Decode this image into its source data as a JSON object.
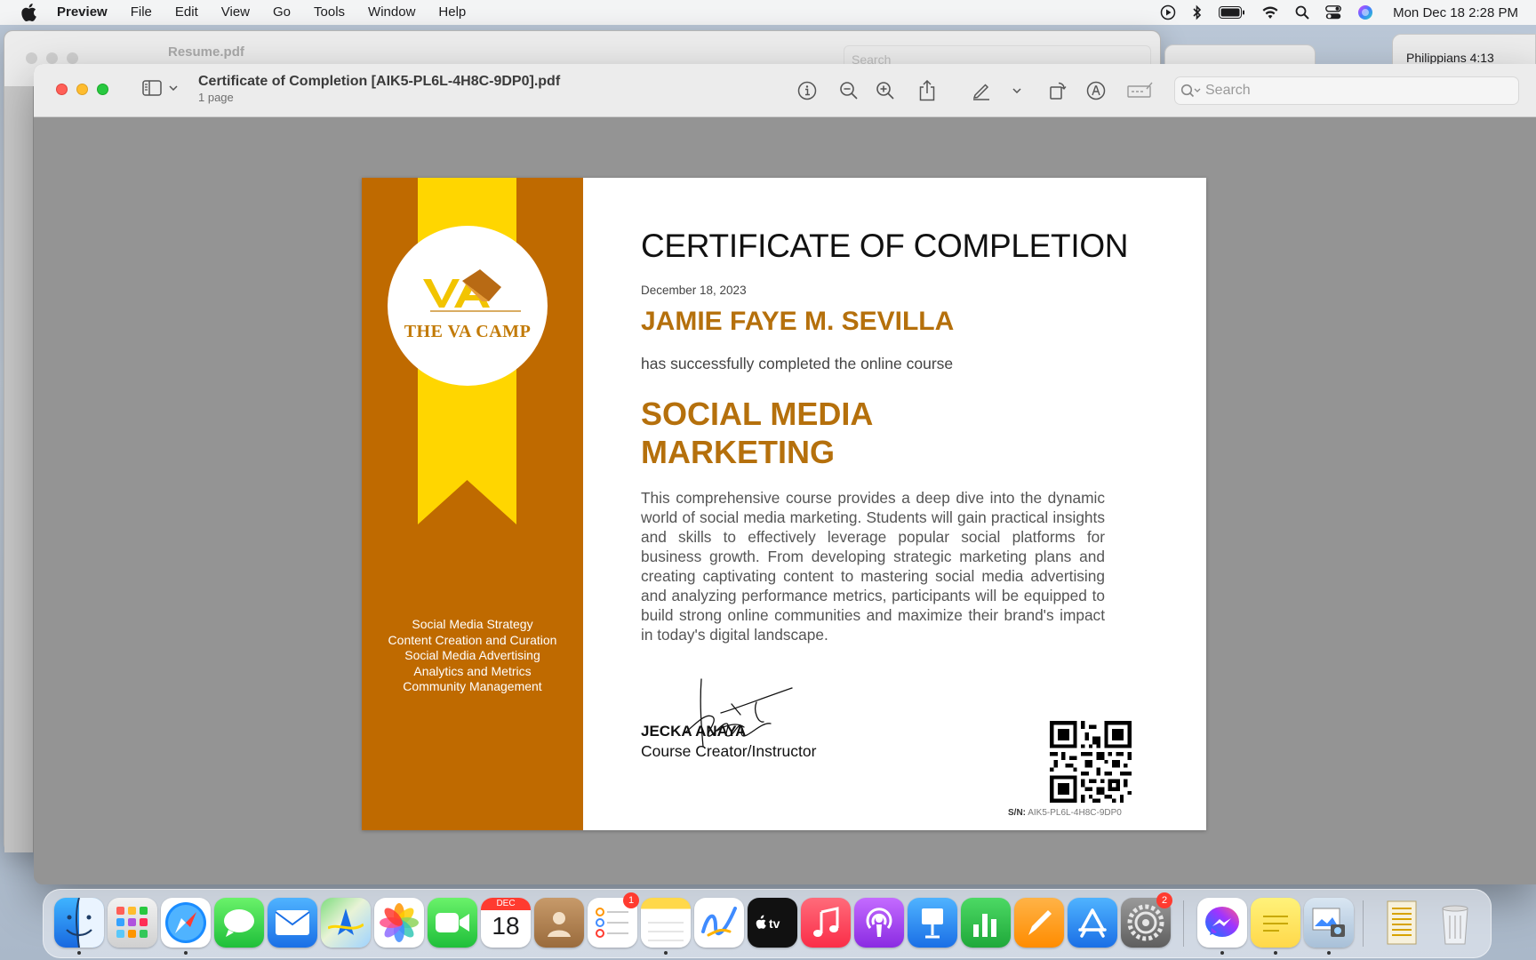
{
  "menubar": {
    "app_name": "Preview",
    "menus": [
      "File",
      "Edit",
      "View",
      "Go",
      "Tools",
      "Window",
      "Help"
    ],
    "clock": "Mon Dec 18  2:28 PM"
  },
  "background_windows": {
    "resume_title": "Resume.pdf",
    "search_placeholder": "Search",
    "bible_title": "Philippians 4:13"
  },
  "window": {
    "title": "Certificate of Completion [AIK5-PL6L-4H8C-9DP0].pdf",
    "subtitle": "1 page",
    "search_placeholder": "Search"
  },
  "certificate": {
    "logo_text": "THE VA CAMP",
    "topics": [
      "Social Media Strategy",
      "Content Creation and Curation",
      "Social Media Advertising",
      "Analytics and Metrics",
      "Community Management"
    ],
    "heading": "CERTIFICATE OF COMPLETION",
    "date": "December 18, 2023",
    "recipient": "JAMIE FAYE M. SEVILLA",
    "intro": "has successfully completed the online course",
    "course_line1": "SOCIAL MEDIA",
    "course_line2": "MARKETING",
    "description": "This comprehensive course provides a deep dive into the dynamic world of social media marketing. Students will gain practical insights and skills to effectively leverage popular social platforms for business growth. From developing strategic marketing plans and creating captivating content to mastering social media advertising and analyzing performance metrics, participants will be equipped to build strong online communities and maximize their brand's impact in today's digital landscape.",
    "instructor_name": "JECKA ANAYA",
    "instructor_role": "Course Creator/Instructor",
    "serial_label": "S/N:",
    "serial_value": "AIK5-PL6L-4H8C-9DP0",
    "colors": {
      "brand_orange": "#bf6a00",
      "ribbon_yellow": "#ffd600",
      "title_gold": "#b5700c"
    }
  },
  "dock": {
    "calendar_month": "DEC",
    "calendar_day": "18",
    "reminders_badge": "1",
    "settings_badge": "2",
    "apps": [
      "finder-icon",
      "launchpad-icon",
      "safari-icon",
      "messages-icon",
      "mail-icon",
      "maps-icon",
      "photos-icon",
      "facetime-icon",
      "calendar-icon",
      "contacts-icon",
      "reminders-icon",
      "notes-icon",
      "freeform-icon",
      "apple-tv-icon",
      "music-icon",
      "podcasts-icon",
      "keynote-icon",
      "numbers-icon",
      "pages-icon",
      "app-store-icon",
      "system-settings-icon",
      "messenger-icon",
      "stickies-icon",
      "preview-icon",
      "documents-icon",
      "trash-icon"
    ]
  }
}
